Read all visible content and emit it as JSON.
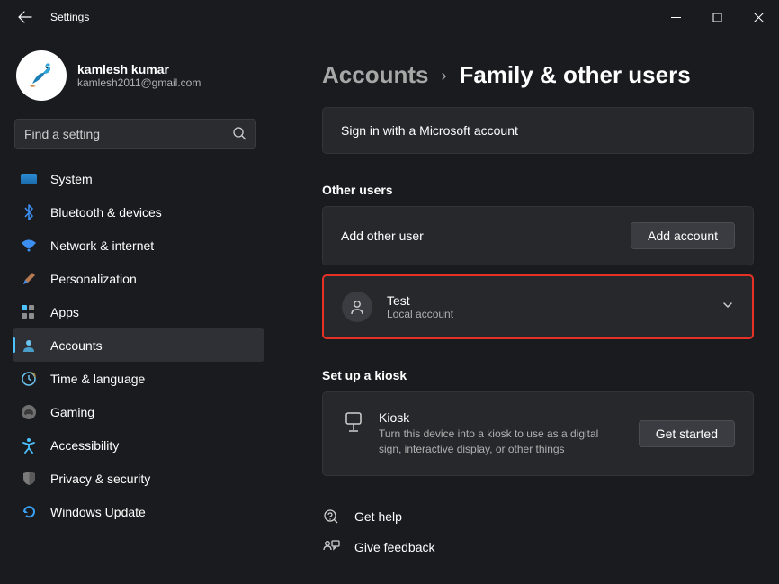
{
  "window": {
    "title": "Settings"
  },
  "user": {
    "name": "kamlesh kumar",
    "email": "kamlesh2011@gmail.com"
  },
  "search": {
    "placeholder": "Find a setting"
  },
  "nav": {
    "items": [
      {
        "label": "System"
      },
      {
        "label": "Bluetooth & devices"
      },
      {
        "label": "Network & internet"
      },
      {
        "label": "Personalization"
      },
      {
        "label": "Apps"
      },
      {
        "label": "Accounts"
      },
      {
        "label": "Time & language"
      },
      {
        "label": "Gaming"
      },
      {
        "label": "Accessibility"
      },
      {
        "label": "Privacy & security"
      },
      {
        "label": "Windows Update"
      }
    ],
    "active": 5
  },
  "breadcrumb": {
    "parent": "Accounts",
    "current": "Family & other users"
  },
  "signin_card": {
    "text": "Sign in with a Microsoft account"
  },
  "other_users": {
    "title": "Other users",
    "add_label": "Add other user",
    "add_button": "Add account",
    "user": {
      "name": "Test",
      "type": "Local account"
    }
  },
  "kiosk": {
    "section_title": "Set up a kiosk",
    "title": "Kiosk",
    "desc": "Turn this device into a kiosk to use as a digital sign, interactive display, or other things",
    "button": "Get started"
  },
  "help": {
    "get_help": "Get help",
    "feedback": "Give feedback"
  }
}
